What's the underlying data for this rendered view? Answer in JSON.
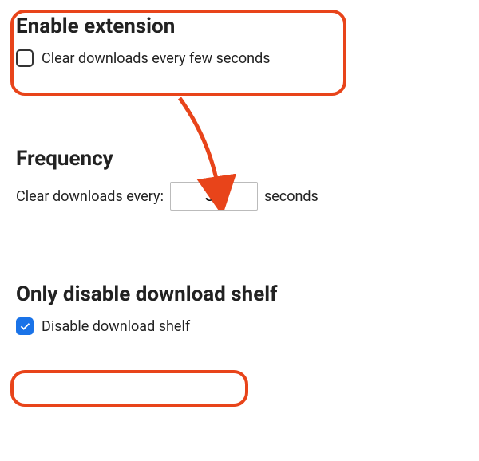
{
  "section1": {
    "title": "Enable extension",
    "checkbox_label": "Clear downloads every few seconds",
    "checkbox_checked": false
  },
  "section2": {
    "title": "Frequency",
    "label_before": "Clear downloads every:",
    "input_value": "30",
    "label_after": "seconds"
  },
  "section3": {
    "title": "Only disable download shelf",
    "checkbox_label": "Disable download shelf",
    "checkbox_checked": true
  }
}
